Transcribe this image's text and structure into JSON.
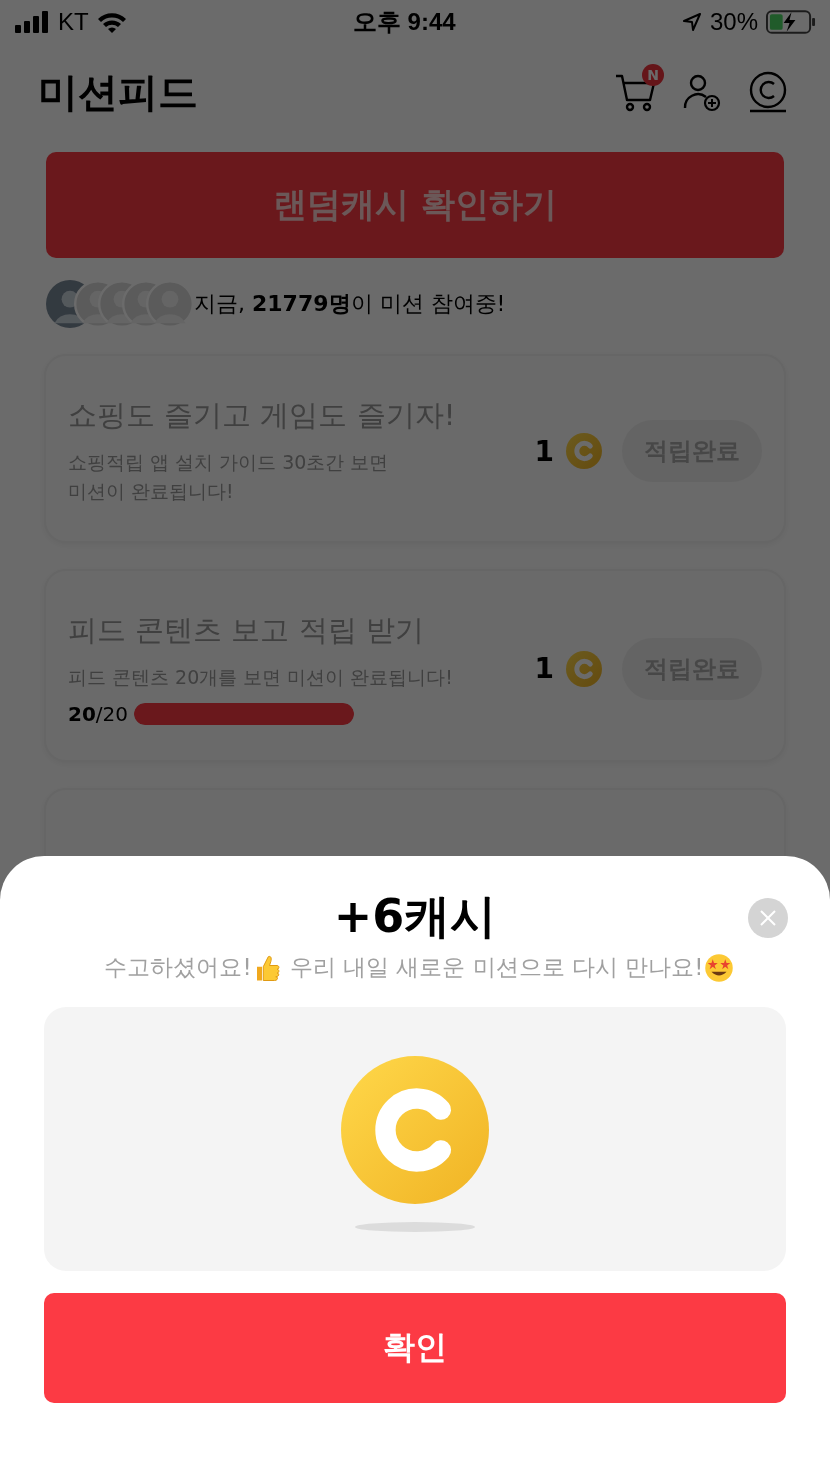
{
  "status_bar": {
    "carrier": "KT",
    "time": "오후 9:44",
    "battery": "30%",
    "charging": true
  },
  "header": {
    "title": "미션피드",
    "cart_badge": "N"
  },
  "random_cash_button": "랜덤캐시 확인하기",
  "participants": {
    "text": "지금, **21779명**이 미션 참여중!"
  },
  "missions": [
    {
      "title": "쇼핑도 즐기고 게임도 즐기자!",
      "description": "쇼핑적립 앱 설치 가이드 30초간 보면\n미션이 완료됩니다!",
      "reward": "1",
      "button": "적립완료",
      "completed": true
    },
    {
      "title": "피드 콘텐츠 보고 적립 받기",
      "description": "피드 콘텐츠 20개를 보면 미션이 완료됩니다!",
      "reward": "1",
      "button": "적립완료",
      "completed": true,
      "progress": {
        "count": "**20**/20",
        "level": 1
      }
    }
  ],
  "reward_sheet": {
    "title": "+6캐시",
    "message": [
      "수고하셨어요!",
      "우리 내일 새로운 미션으로 다시 만나요!"
    ],
    "confirm_button": "확인"
  }
}
